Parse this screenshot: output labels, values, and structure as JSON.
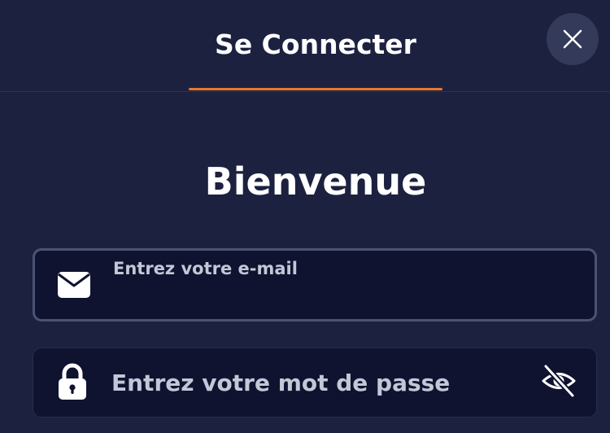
{
  "header": {
    "tab_login_label": "Se Connecter"
  },
  "welcome": {
    "title": "Bienvenue"
  },
  "email": {
    "label": "Entrez votre e-mail",
    "value": ""
  },
  "password": {
    "placeholder": "Entrez votre mot de passe",
    "value": ""
  },
  "icons": {
    "close": "close-icon",
    "email": "envelope-icon",
    "password": "lock-icon",
    "visibility": "eye-slash-icon"
  },
  "colors": {
    "background": "#1c2140",
    "input_background": "#0f1330",
    "accent": "#e8772e",
    "close_button": "#333a5a",
    "muted_text": "#c4c7d6"
  }
}
